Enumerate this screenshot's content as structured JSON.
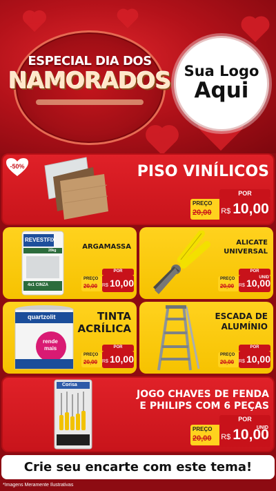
{
  "header": {
    "badge_line1": "ESPECIAL DIA DOS",
    "badge_line2": "NAMORADOS",
    "logo_line1": "Sua Logo",
    "logo_line2": "Aqui"
  },
  "products": [
    {
      "name": "PISO VINÍLICOS",
      "discount": "-50%",
      "price_label": "POR",
      "preco": "PREÇO",
      "old_price": "20,00",
      "currency": "R$",
      "new_price": "10,00"
    },
    {
      "name": "ARGAMASSA",
      "price_label": "POR",
      "preco": "PREÇO",
      "old_price": "20,00",
      "currency": "R$",
      "new_price": "10,00",
      "package_brand": "REVESTFIX",
      "package_weight": "20kg",
      "package_type": "4x1 CINZA"
    },
    {
      "name_line1": "ALICATE",
      "name_line2": "UNIVERSAL",
      "price_label": "POR",
      "preco": "PREÇO",
      "old_price": "20,00",
      "currency": "R$",
      "new_price": "10,00",
      "unit": "UNID"
    },
    {
      "name_line1": "TINTA",
      "name_line2": "ACRÍLICA",
      "price_label": "POR",
      "preco": "PREÇO",
      "old_price": "20,00",
      "currency": "R$",
      "new_price": "10,00",
      "can_brand": "quartzolit",
      "can_tag1": "rende",
      "can_tag2": "mais"
    },
    {
      "name_line1": "ESCADA DE",
      "name_line2": "ALUMÍNIO",
      "price_label": "POR",
      "preco": "PREÇO",
      "old_price": "20,00",
      "currency": "R$",
      "new_price": "10,00"
    },
    {
      "name_line1": "JOGO CHAVES DE FENDA",
      "name_line2": "E PHILIPS COM 6 PEÇAS",
      "price_label": "POR",
      "preco": "PREÇO",
      "old_price": "20,00",
      "currency": "R$",
      "new_price": "10,00",
      "unit": "UNID",
      "pack_brand": "Corisa"
    }
  ],
  "footer": {
    "cta": "Crie seu encarte com este tema!",
    "disclaimer": "*Imagens Meramente Ilustrativas"
  },
  "colors": {
    "red": "#c8121a",
    "yellow": "#ffd21e",
    "dark_red": "#8d0b12"
  }
}
